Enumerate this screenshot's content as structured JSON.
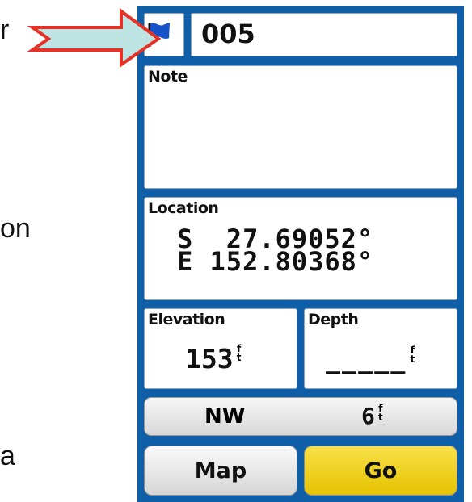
{
  "left_labels": [
    "r",
    "on",
    "a"
  ],
  "header": {
    "waypoint_name": "005",
    "flag_icon": "waypoint-flag-icon"
  },
  "note": {
    "label": "Note",
    "text": ""
  },
  "location": {
    "label": "Location",
    "lat": "S  27.69052°",
    "lon": "E 152.80368°"
  },
  "elevation": {
    "label": "Elevation",
    "value": "153",
    "unit_top": "f",
    "unit_bottom": "t"
  },
  "depth": {
    "label": "Depth",
    "value": "_____",
    "unit_top": "f",
    "unit_bottom": "t"
  },
  "bearing_bar": {
    "direction": "NW",
    "distance": "6",
    "unit_top": "f",
    "unit_bottom": "t"
  },
  "buttons": {
    "map_label": "Map",
    "go_label": "Go"
  },
  "colors": {
    "device_frame": "#0f5ea8",
    "arrow_fill": "#bde3e2",
    "arrow_stroke": "#e53227",
    "flag": "#1652c8",
    "go_button": "#f2d224",
    "map_button": "#e8e8e8"
  }
}
